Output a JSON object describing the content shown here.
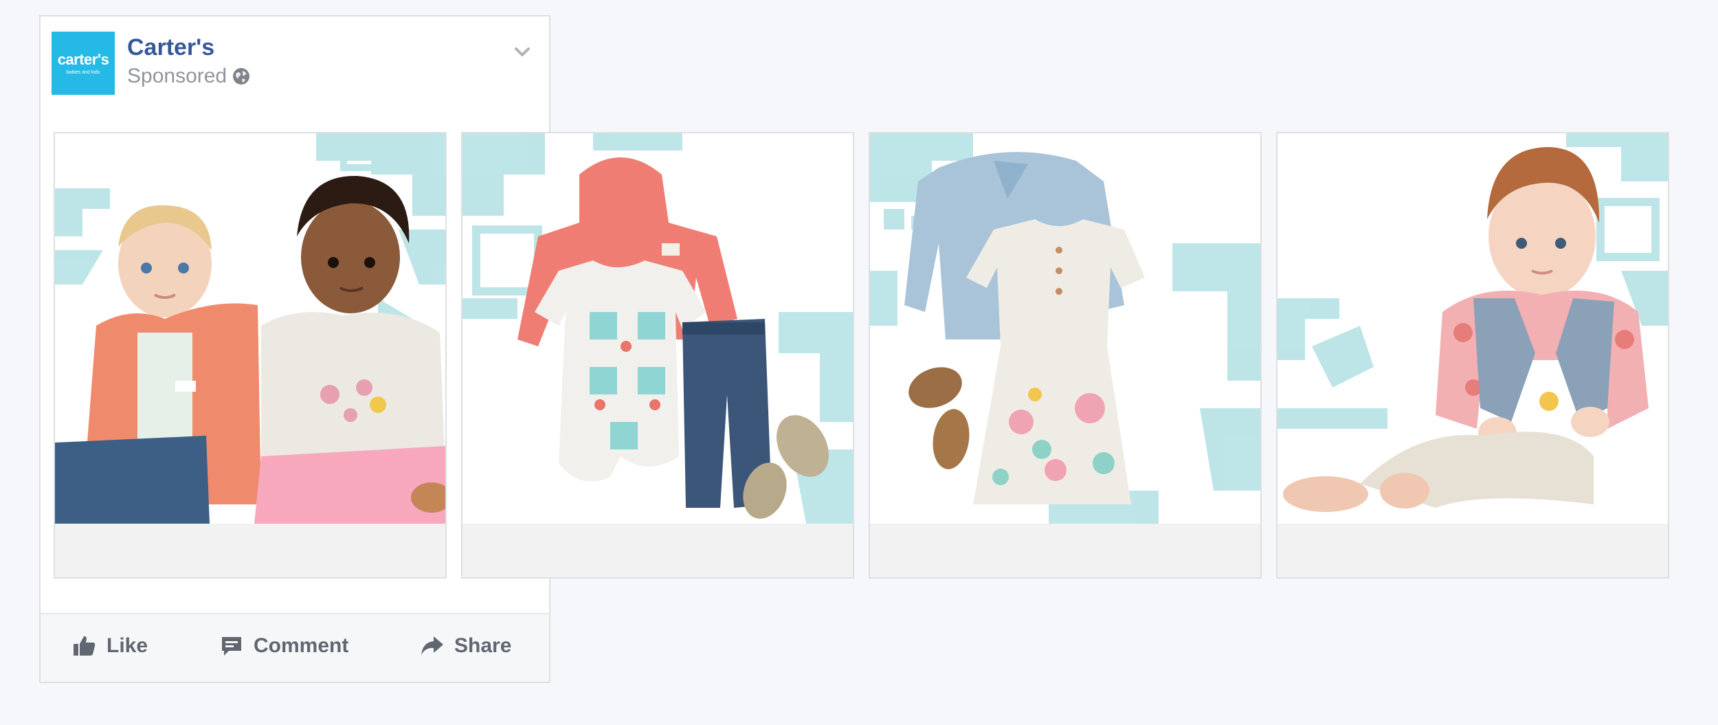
{
  "post": {
    "page_name": "Carter's",
    "sponsored_label": "Sponsored",
    "logo": {
      "main_text": "carter's",
      "sub_text": "babies and kids",
      "color": "#25b9e6"
    },
    "icons": {
      "audience": "globe-icon",
      "menu": "chevron-down-icon"
    }
  },
  "carousel": {
    "cards": [
      {
        "image": "two-babies-photo",
        "subject": "babies"
      },
      {
        "image": "outfit-flatlay-hoodie",
        "subject": "outfit"
      },
      {
        "image": "outfit-flatlay-dress",
        "subject": "outfit"
      },
      {
        "image": "baby-in-vest-photo",
        "subject": "baby"
      }
    ],
    "pattern_color": "#a8dde0"
  },
  "actions": {
    "like_label": "Like",
    "comment_label": "Comment",
    "share_label": "Share"
  },
  "colors": {
    "brand_link": "#365899",
    "muted": "#90949c",
    "action": "#606770"
  }
}
